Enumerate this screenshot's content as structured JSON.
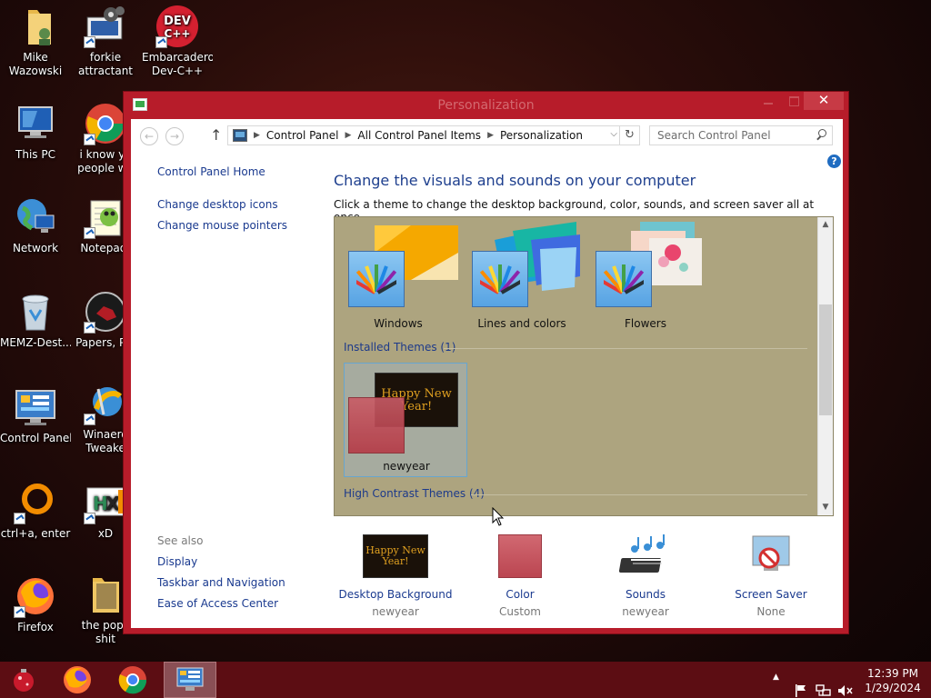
{
  "desktop": {
    "icons": [
      {
        "label": "Mike Wazowski"
      },
      {
        "label": "forkie attractant"
      },
      {
        "label": "Embarcadero Dev-C++"
      },
      {
        "label": "This PC"
      },
      {
        "label": "i know yo people wo"
      },
      {
        "label": "Network"
      },
      {
        "label": "Notepad-"
      },
      {
        "label": "MEMZ-Dest..."
      },
      {
        "label": "Papers, Ple"
      },
      {
        "label": "Control Panel"
      },
      {
        "label": "Winaero Tweake"
      },
      {
        "label": "ctrl+a, enter"
      },
      {
        "label": "xD"
      },
      {
        "label": "Firefox"
      },
      {
        "label": "the popc shit"
      }
    ],
    "devcpp_icon_text": "DEV C++"
  },
  "window": {
    "title": "Personalization",
    "close_glyph": "✕",
    "address": {
      "back_glyph": "←",
      "forward_glyph": "→",
      "up_glyph": "↑",
      "crumbs": [
        "Control Panel",
        "All Control Panel Items",
        "Personalization"
      ],
      "sep_glyph": "▶",
      "dropdown_glyph": "⌵",
      "refresh_glyph": "↻"
    },
    "search_placeholder": "Search Control Panel",
    "help_glyph": "?",
    "left_pane": {
      "home": "Control Panel Home",
      "links": [
        "Change desktop icons",
        "Change mouse pointers"
      ],
      "see_also": "See also",
      "see_also_links": [
        "Display",
        "Taskbar and Navigation",
        "Ease of Access Center"
      ]
    },
    "main": {
      "title": "Change the visuals and sounds on your computer",
      "subtitle": "Click a theme to change the desktop background, color, sounds, and screen saver all at once.",
      "themes": [
        {
          "name": "Windows"
        },
        {
          "name": "Lines and colors"
        },
        {
          "name": "Flowers"
        }
      ],
      "installed_header": "Installed Themes (1)",
      "installed_theme": {
        "name": "newyear",
        "preview_text": "Happy New Year!"
      },
      "high_contrast_header": "High Contrast Themes (4)",
      "scroll_up_glyph": "▲",
      "scroll_down_glyph": "▼"
    },
    "bottom": [
      {
        "link": "Desktop Background",
        "value": "newyear",
        "preview_text": "Happy New Year!"
      },
      {
        "link": "Color",
        "value": "Custom"
      },
      {
        "link": "Sounds",
        "value": "newyear"
      },
      {
        "link": "Screen Saver",
        "value": "None"
      }
    ]
  },
  "taskbar": {
    "tray": {
      "up_glyph": "▲"
    },
    "clock": {
      "time": "12:39 PM",
      "date": "1/29/2024"
    }
  },
  "colors": {
    "window_frame": "#b71c2a",
    "taskbar": "#5c0d13",
    "link_blue": "#1a3a8f",
    "theme_panel": "#ada47f",
    "accent_color_swatch": "#c7545e"
  }
}
